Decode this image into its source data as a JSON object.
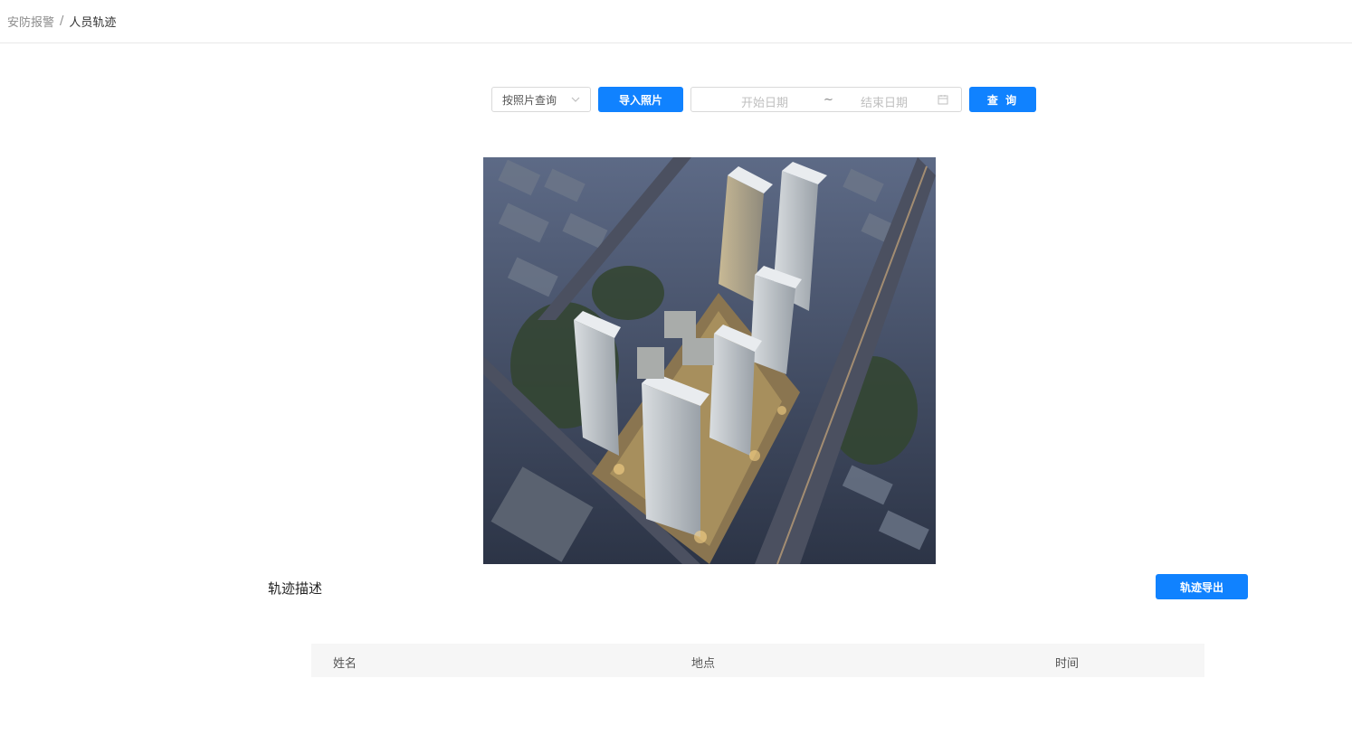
{
  "breadcrumb": {
    "parent": "安防报警",
    "separator": "/",
    "current": "人员轨迹"
  },
  "toolbar": {
    "query_mode": "按照片查询",
    "import_label": "导入照片",
    "date_start_placeholder": "开始日期",
    "date_separator": "~",
    "date_end_placeholder": "结束日期",
    "query_label": "查 询"
  },
  "photo": {
    "icon": "aerial-building-photo"
  },
  "track": {
    "title": "轨迹描述",
    "export_label": "轨迹导出",
    "columns": [
      "姓名",
      "地点",
      "时间"
    ]
  },
  "colors": {
    "primary": "#1082ff",
    "header_bg": "#f6f6f6",
    "border": "#d9d9d9"
  }
}
